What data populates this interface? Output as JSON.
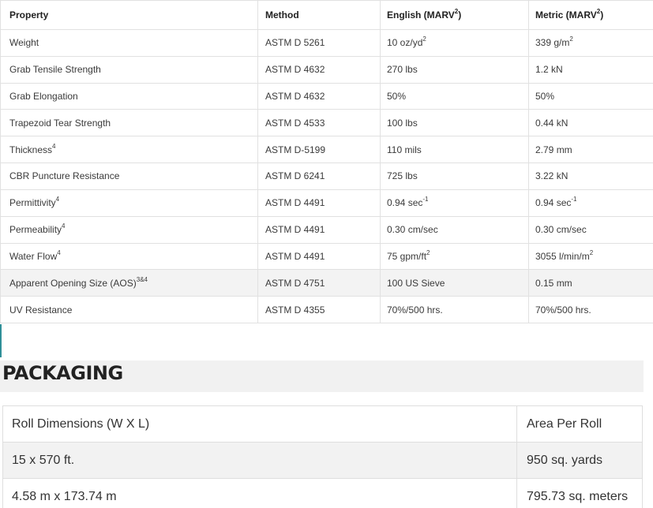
{
  "properties_table": {
    "headers": {
      "property": "Property",
      "method": "Method",
      "english": "English (MARV",
      "english_sup": "2",
      "english_close": ")",
      "metric": "Metric (MARV",
      "metric_sup": "2",
      "metric_close": ")"
    },
    "rows": [
      {
        "property": "Weight",
        "property_sup": "",
        "method": "ASTM D 5261",
        "english": "10 oz/yd",
        "english_sup": "2",
        "metric": "339 g/m",
        "metric_sup": "2",
        "shaded": false
      },
      {
        "property": "Grab Tensile Strength",
        "property_sup": "",
        "method": "ASTM D 4632",
        "english": "270 lbs",
        "english_sup": "",
        "metric": "1.2 kN",
        "metric_sup": "",
        "shaded": false
      },
      {
        "property": "Grab Elongation",
        "property_sup": "",
        "method": "ASTM D 4632",
        "english": "50%",
        "english_sup": "",
        "metric": "50%",
        "metric_sup": "",
        "shaded": false
      },
      {
        "property": "Trapezoid Tear Strength",
        "property_sup": "",
        "method": "ASTM D 4533",
        "english": "100 lbs",
        "english_sup": "",
        "metric": "0.44 kN",
        "metric_sup": "",
        "shaded": false
      },
      {
        "property": "Thickness",
        "property_sup": "4",
        "method": "ASTM D-5199",
        "english": "110 mils",
        "english_sup": "",
        "metric": "2.79 mm",
        "metric_sup": "",
        "shaded": false
      },
      {
        "property": "CBR Puncture Resistance",
        "property_sup": "",
        "method": "ASTM D 6241",
        "english": "725 lbs",
        "english_sup": "",
        "metric": "3.22 kN",
        "metric_sup": "",
        "shaded": false
      },
      {
        "property": "Permittivity",
        "property_sup": "4",
        "method": "ASTM D 4491",
        "english": "0.94 sec",
        "english_sup": "-1",
        "metric": "0.94 sec",
        "metric_sup": "-1",
        "shaded": false
      },
      {
        "property": "Permeability",
        "property_sup": "4",
        "method": "ASTM D 4491",
        "english": "0.30 cm/sec",
        "english_sup": "",
        "metric": "0.30 cm/sec",
        "metric_sup": "",
        "shaded": false
      },
      {
        "property": "Water Flow",
        "property_sup": "4",
        "method": "ASTM D 4491",
        "english": "75 gpm/ft",
        "english_sup": "2",
        "metric": "3055 l/min/m",
        "metric_sup": "2",
        "shaded": false
      },
      {
        "property": "Apparent Opening Size (AOS)",
        "property_sup": "3&4",
        "method": "ASTM D 4751",
        "english": "100 US Sieve",
        "english_sup": "",
        "metric": "0.15 mm",
        "metric_sup": "",
        "shaded": true
      },
      {
        "property": "UV Resistance",
        "property_sup": "",
        "method": "ASTM D 4355",
        "english": "70%/500 hrs.",
        "english_sup": "",
        "metric": "70%/500 hrs.",
        "metric_sup": "",
        "shaded": false
      }
    ]
  },
  "packaging": {
    "title": "PACKAGING",
    "headers": {
      "dimensions": "Roll Dimensions (W X L)",
      "area": "Area Per Roll"
    },
    "rows": [
      {
        "dimensions": "15 x 570 ft.",
        "area": "950 sq. yards",
        "shaded": true
      },
      {
        "dimensions": "4.58 m x 173.74 m",
        "area": "795.73 sq. meters",
        "shaded": false
      }
    ]
  },
  "colors": {
    "accent": "#2f8f98",
    "shaded_row": "#f2f2f2",
    "border": "#e1e1e1"
  }
}
